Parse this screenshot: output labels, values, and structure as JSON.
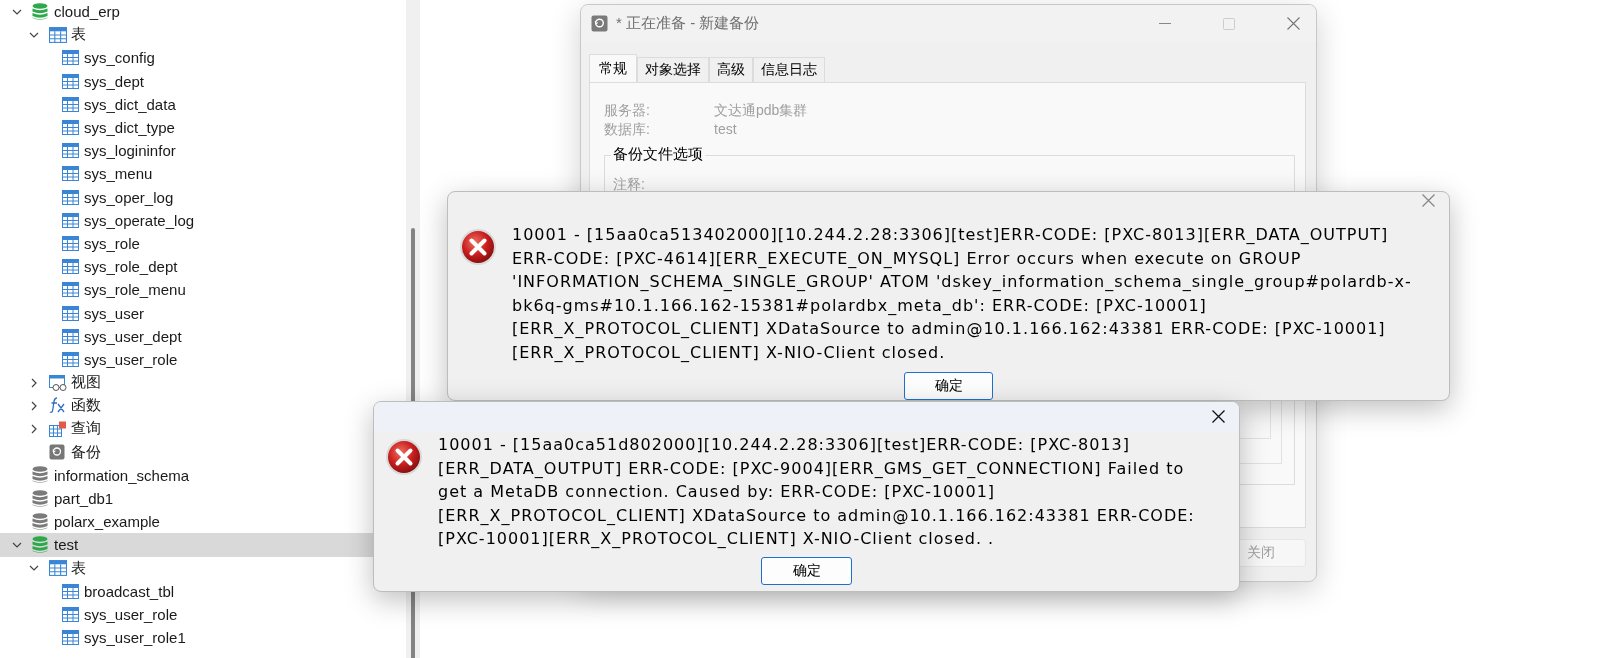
{
  "tree": [
    {
      "label": "cloud_erp",
      "kind": "database",
      "open": true,
      "expanded": true,
      "selected": false,
      "children": [
        {
          "label": "表",
          "kind": "tables",
          "expanded": true,
          "selected": false,
          "children": [
            {
              "label": "sys_config",
              "kind": "table",
              "selected": false
            },
            {
              "label": "sys_dept",
              "kind": "table",
              "selected": false
            },
            {
              "label": "sys_dict_data",
              "kind": "table",
              "selected": false
            },
            {
              "label": "sys_dict_type",
              "kind": "table",
              "selected": false
            },
            {
              "label": "sys_logininfor",
              "kind": "table",
              "selected": false
            },
            {
              "label": "sys_menu",
              "kind": "table",
              "selected": false
            },
            {
              "label": "sys_oper_log",
              "kind": "table",
              "selected": false
            },
            {
              "label": "sys_operate_log",
              "kind": "table",
              "selected": false
            },
            {
              "label": "sys_role",
              "kind": "table",
              "selected": false
            },
            {
              "label": "sys_role_dept",
              "kind": "table",
              "selected": false
            },
            {
              "label": "sys_role_menu",
              "kind": "table",
              "selected": false
            },
            {
              "label": "sys_user",
              "kind": "table",
              "selected": false
            },
            {
              "label": "sys_user_dept",
              "kind": "table",
              "selected": false
            },
            {
              "label": "sys_user_role",
              "kind": "table",
              "selected": false
            }
          ]
        },
        {
          "label": "视图",
          "kind": "views",
          "expanded": false,
          "selected": false
        },
        {
          "label": "函数",
          "kind": "functions",
          "expanded": false,
          "selected": false
        },
        {
          "label": "查询",
          "kind": "queries",
          "expanded": false,
          "selected": false
        },
        {
          "label": "备份",
          "kind": "backups",
          "selected": false
        }
      ]
    },
    {
      "label": "information_schema",
      "kind": "database",
      "open": false,
      "selected": false
    },
    {
      "label": "part_db1",
      "kind": "database",
      "open": false,
      "selected": false
    },
    {
      "label": "polarx_example",
      "kind": "database",
      "open": false,
      "selected": false
    },
    {
      "label": "test",
      "kind": "database",
      "open": true,
      "expanded": true,
      "selected": true,
      "children": [
        {
          "label": "表",
          "kind": "tables",
          "expanded": true,
          "selected": false,
          "children": [
            {
              "label": "broadcast_tbl",
              "kind": "table",
              "selected": false
            },
            {
              "label": "sys_user_role",
              "kind": "table",
              "selected": false
            },
            {
              "label": "sys_user_role1",
              "kind": "table",
              "selected": false
            }
          ]
        }
      ]
    }
  ],
  "backup_window": {
    "title": "* 正在准备 - 新建备份",
    "tabs": [
      {
        "label": "常规",
        "selected": true
      },
      {
        "label": "对象选择",
        "selected": false
      },
      {
        "label": "高级",
        "selected": false
      },
      {
        "label": "信息日志",
        "selected": false
      }
    ],
    "info": [
      {
        "label": "服务器:",
        "value": "文达通pdb集群"
      },
      {
        "label": "数据库:",
        "value": "test"
      }
    ],
    "group_title": "备份文件选项",
    "comment_label": "注释:",
    "close_button": {
      "label": "关闭",
      "disabled": true
    }
  },
  "dialogs": [
    {
      "active": false,
      "message": "10001 - [15aa0ca513402000][10.244.2.28:3306][test]ERR-CODE: [PXC-8013][ERR_DATA_OUTPUT] ERR-CODE: [PXC-4614][ERR_EXECUTE_ON_MYSQL] Error occurs when execute on GROUP 'INFORMATION_SCHEMA_SINGLE_GROUP' ATOM 'dskey_information_schema_single_group#polardb-x-bk6q-gms#10.1.166.162-15381#polardbx_meta_db': ERR-CODE: [PXC-10001][ERR_X_PROTOCOL_CLIENT] XDataSource to admin@10.1.166.162:43381 ERR-CODE: [PXC-10001][ERR_X_PROTOCOL_CLIENT] X-NIO-Client closed.",
      "button": "确定"
    },
    {
      "active": true,
      "message": "10001 - [15aa0ca51d802000][10.244.2.28:3306][test]ERR-CODE: [PXC-8013][ERR_DATA_OUTPUT] ERR-CODE: [PXC-9004][ERR_GMS_GET_CONNECTION] Failed to get a MetaDB connection. Caused by: ERR-CODE: [PXC-10001][ERR_X_PROTOCOL_CLIENT] XDataSource to admin@10.1.166.162:43381 ERR-CODE: [PXC-10001][ERR_X_PROTOCOL_CLIENT] X-NIO-Client closed.  .",
      "button": "确定"
    }
  ]
}
